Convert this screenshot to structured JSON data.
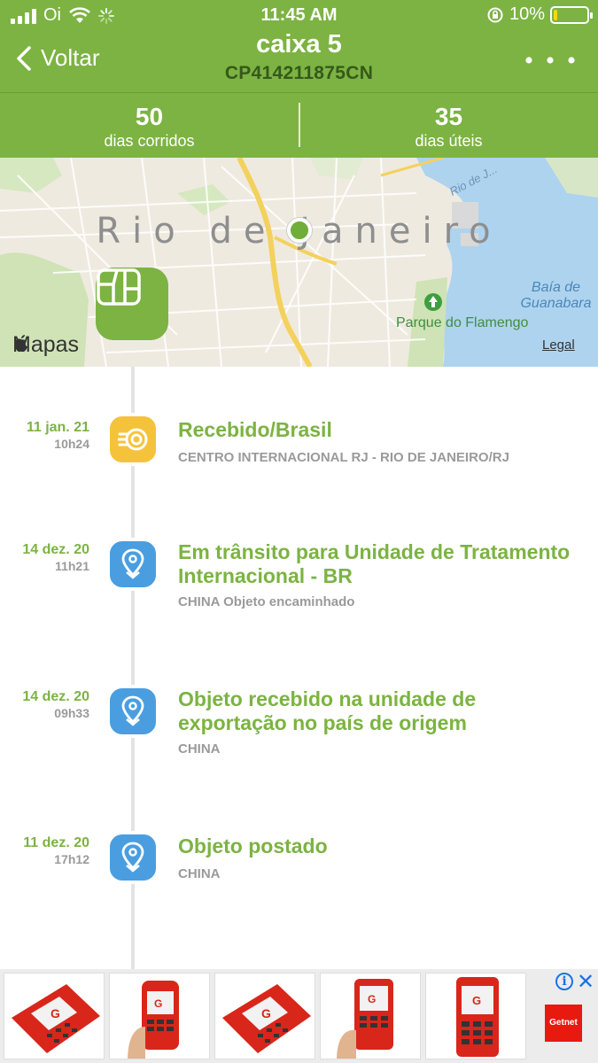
{
  "status_bar": {
    "carrier": "Oi",
    "time": "11:45 AM",
    "battery_percent": "10%",
    "battery_level": 0.1
  },
  "nav": {
    "back_label": "Voltar",
    "title": "caixa 5",
    "tracking_code": "CP414211875CN"
  },
  "stats": [
    {
      "value": "50",
      "label": "dias corridos"
    },
    {
      "value": "35",
      "label": "dias úteis"
    }
  ],
  "map": {
    "city_label": "Rio de Janeiro",
    "bay_label": "Baía de Guanabara",
    "park_label": "Parque do Flamengo",
    "road_label": "Rio de J...",
    "brand": "Mapas",
    "legal_label": "Legal"
  },
  "events": [
    {
      "date": "11 jan. 21",
      "time": "10h24",
      "title": "Recebido/Brasil",
      "description": "CENTRO INTERNACIONAL RJ - RIO DE JANEIRO/RJ",
      "icon": "received-icon",
      "color": "#f5c33b"
    },
    {
      "date": "14 dez. 20",
      "time": "11h21",
      "title": "Em trânsito para Unidade de Tratamento Internacional - BR",
      "description": "CHINA Objeto encaminhado",
      "icon": "location-pin-icon",
      "color": "#4a9ee0"
    },
    {
      "date": "14 dez. 20",
      "time": "09h33",
      "title": "Objeto recebido na unidade de exportação no país de origem",
      "description": "CHINA",
      "icon": "location-pin-icon",
      "color": "#4a9ee0"
    },
    {
      "date": "11 dez. 20",
      "time": "17h12",
      "title": "Objeto postado",
      "description": "CHINA",
      "icon": "location-pin-icon",
      "color": "#4a9ee0"
    }
  ],
  "ad": {
    "brand": "Getnet"
  },
  "colors": {
    "header_green": "#7cb342",
    "accent_green": "#7cb342",
    "muted_text": "#9a9a9a"
  }
}
